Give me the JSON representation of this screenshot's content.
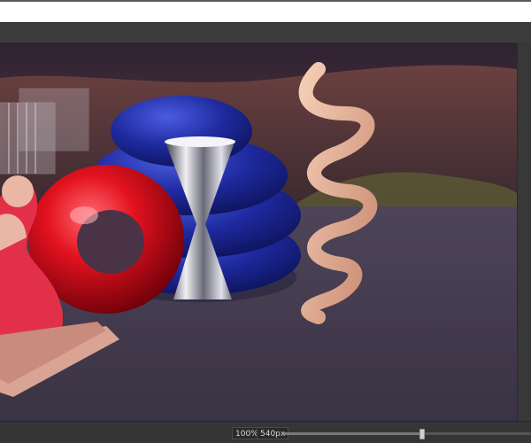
{
  "status": {
    "zoom_label": "100%",
    "size_label": "540px",
    "slider_fraction": 0.56
  },
  "canvas": {
    "image_description_icon": "render-scene",
    "colors": {
      "sky": "#3c2b3c",
      "ground": "#4a3f52",
      "torus": "#e0101c",
      "blue_blob": "#1c2a9c",
      "spiral": "#e7b59a",
      "statue": "#e9b7a5"
    }
  }
}
